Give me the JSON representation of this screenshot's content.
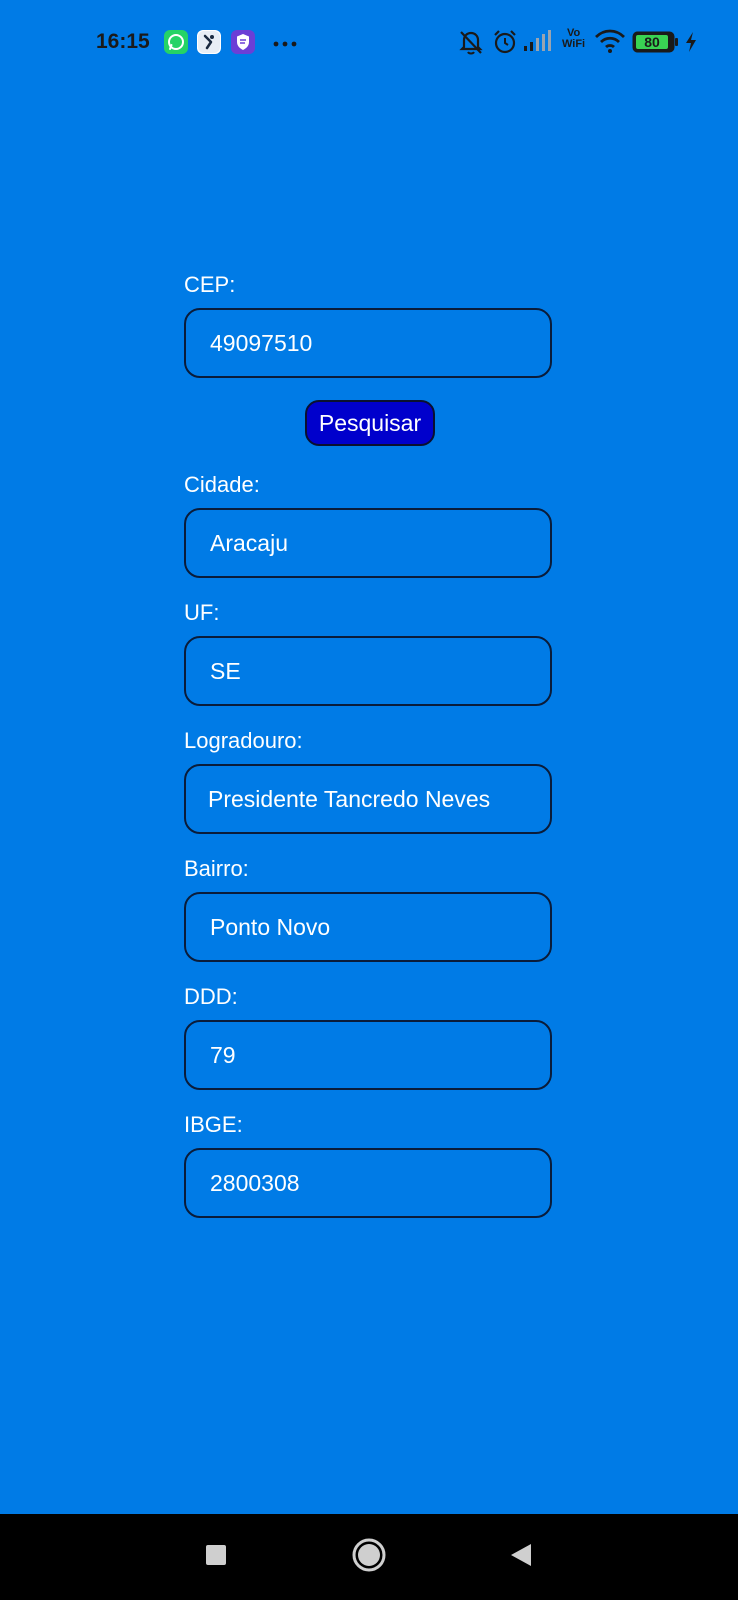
{
  "status_bar": {
    "time": "16:15",
    "battery_level": "80",
    "vowifi_line1": "Vo",
    "vowifi_line2": "WiFi"
  },
  "form": {
    "cep": {
      "label": "CEP:",
      "value": "49097510"
    },
    "search_button_label": "Pesquisar",
    "cidade": {
      "label": "Cidade:",
      "value": "Aracaju"
    },
    "uf": {
      "label": "UF:",
      "value": "SE"
    },
    "logradouro": {
      "label": "Logradouro:",
      "value": "Presidente Tancredo Neves"
    },
    "bairro": {
      "label": "Bairro:",
      "value": "Ponto Novo"
    },
    "ddd": {
      "label": "DDD:",
      "value": "79"
    },
    "ibge": {
      "label": "IBGE:",
      "value": "2800308"
    }
  },
  "colors": {
    "background": "#007be6",
    "button": "#0000cc",
    "input_border": "#0a1c3a",
    "text": "#ffffff"
  },
  "icons": {
    "status_left": [
      "whatsapp-icon",
      "app-icon",
      "vpn-shield-icon",
      "more-icon"
    ],
    "status_right": [
      "notifications-off-icon",
      "alarm-icon",
      "signal-icon",
      "vowifi-icon",
      "wifi-icon",
      "battery-icon",
      "charging-icon"
    ],
    "nav": [
      "recents-icon",
      "home-icon",
      "back-icon"
    ]
  }
}
